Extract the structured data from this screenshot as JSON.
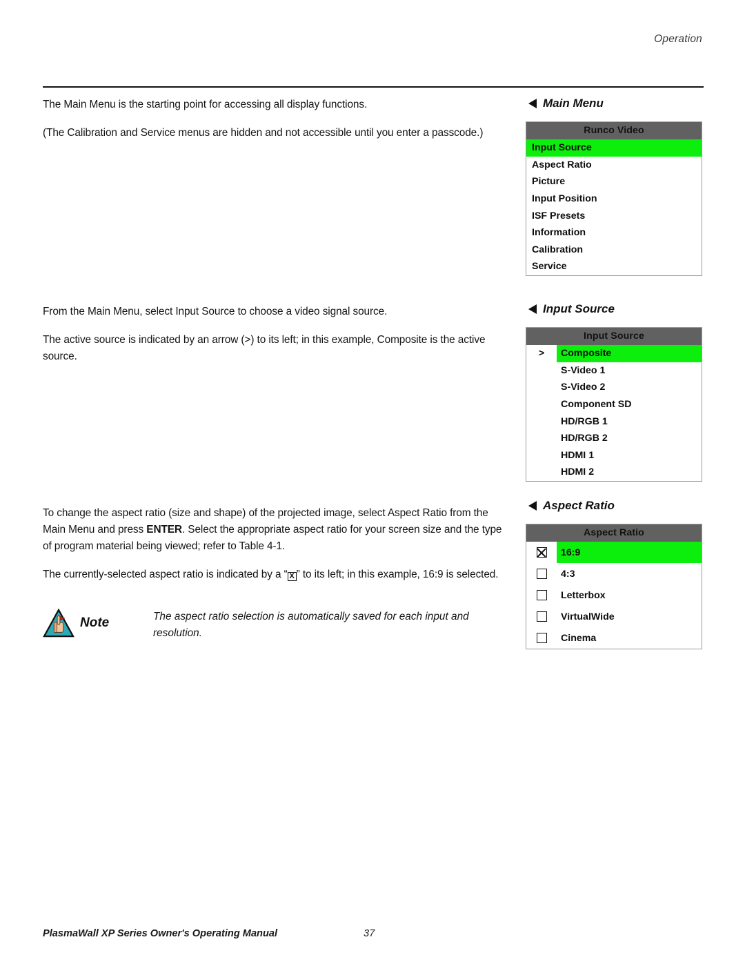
{
  "header": {
    "running_head": "Operation"
  },
  "left_column": {
    "paragraphs_1": [
      "The Main Menu is the starting point for accessing all display functions.",
      "(The Calibration and Service menus are hidden and not accessible until you enter a passcode.)"
    ],
    "paragraphs_2": [
      "From the Main Menu, select Input Source to choose a video signal source.",
      "The active source is indicated by an arrow (>) to its left; in this example, Composite is the active source."
    ],
    "aspect_para_1_a": "To change the aspect ratio (size and shape) of the projected image, select Aspect Ratio from the Main Menu and press ",
    "aspect_para_1_bold": "ENTER",
    "aspect_para_1_b": ". Select the appropriate aspect ratio for your screen size and the type of program material being viewed; refer to Table 4-1.",
    "aspect_para_2_a": "The currently-selected aspect ratio is indicated by a “",
    "aspect_para_2_glyph": "X",
    "aspect_para_2_b": "” to its left; in this example, 16:9 is selected."
  },
  "note": {
    "icon": "note-hand-triangle-icon",
    "label": "Note",
    "text": "The aspect ratio selection is automatically saved for each input and resolution."
  },
  "osd": {
    "colors": {
      "header_gray": "#616161",
      "highlight_green": "#0CEE0C",
      "panel_border": "#9a9a9a"
    },
    "main_menu": {
      "caption": "Main Menu",
      "caption_icon": "triangle-left-icon",
      "panel_title": "Runco Video",
      "items": [
        {
          "label": "Input Source",
          "selected": true
        },
        {
          "label": "Aspect Ratio",
          "selected": false
        },
        {
          "label": "Picture",
          "selected": false
        },
        {
          "label": "Input Position",
          "selected": false
        },
        {
          "label": "ISF Presets",
          "selected": false
        },
        {
          "label": "Information",
          "selected": false
        },
        {
          "label": "Calibration",
          "selected": false
        },
        {
          "label": "Service",
          "selected": false
        }
      ]
    },
    "input_source": {
      "caption": "Input Source",
      "caption_icon": "triangle-left-icon",
      "panel_title": "Input Source",
      "active_marker": ">",
      "items": [
        {
          "label": "Composite",
          "marker": ">",
          "selected": true
        },
        {
          "label": "S-Video 1",
          "marker": "",
          "selected": false
        },
        {
          "label": "S-Video 2",
          "marker": "",
          "selected": false
        },
        {
          "label": "Component SD",
          "marker": "",
          "selected": false
        },
        {
          "label": "HD/RGB 1",
          "marker": "",
          "selected": false
        },
        {
          "label": "HD/RGB 2",
          "marker": "",
          "selected": false
        },
        {
          "label": "HDMI 1",
          "marker": "",
          "selected": false
        },
        {
          "label": "HDMI 2",
          "marker": "",
          "selected": false
        }
      ]
    },
    "aspect_ratio": {
      "caption": "Aspect Ratio",
      "caption_icon": "triangle-left-icon",
      "panel_title": "Aspect Ratio",
      "items": [
        {
          "label": "16:9",
          "checked": true,
          "selected": true
        },
        {
          "label": "4:3",
          "checked": false,
          "selected": false
        },
        {
          "label": "Letterbox",
          "checked": false,
          "selected": false
        },
        {
          "label": "VirtualWide",
          "checked": false,
          "selected": false
        },
        {
          "label": "Cinema",
          "checked": false,
          "selected": false
        }
      ]
    }
  },
  "footer": {
    "manual_title": "PlasmaWall XP Series Owner's Operating Manual",
    "page_number": "37"
  }
}
